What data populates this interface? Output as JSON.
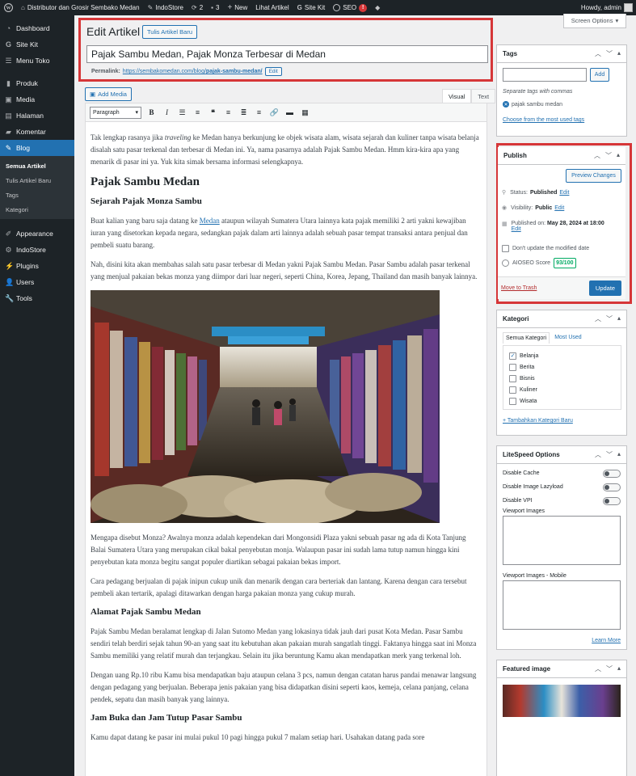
{
  "admin_bar": {
    "site_name": "Distributor dan Grosir Sembako Medan",
    "indostore": "IndoStore",
    "updates_count": "2",
    "comments_count": "3",
    "new_label": "New",
    "view_post": "Lihat Artikel",
    "sitekit": "Site Kit",
    "seo": "SEO",
    "seo_alert": "!",
    "howdy": "Howdy, admin"
  },
  "sidebar": {
    "items": [
      {
        "label": "Dashboard",
        "icon": "dashboard-icon"
      },
      {
        "label": "Site Kit",
        "icon": "sitekit-icon"
      },
      {
        "label": "Menu Toko",
        "icon": "menu-icon"
      },
      {
        "label": "Produk",
        "icon": "product-icon"
      },
      {
        "label": "Media",
        "icon": "media-icon"
      },
      {
        "label": "Halaman",
        "icon": "page-icon"
      },
      {
        "label": "Komentar",
        "icon": "comment-icon"
      },
      {
        "label": "Blog",
        "icon": "pin-icon"
      },
      {
        "label": "Appearance",
        "icon": "appearance-icon"
      },
      {
        "label": "IndoStore",
        "icon": "indostore-icon"
      },
      {
        "label": "Plugins",
        "icon": "plugin-icon"
      },
      {
        "label": "Users",
        "icon": "users-icon"
      },
      {
        "label": "Tools",
        "icon": "tools-icon"
      }
    ],
    "submenu": [
      "Semua Artikel",
      "Tulis Artikel Baru",
      "Tags",
      "Kategori"
    ]
  },
  "screen_options": "Screen Options",
  "editor": {
    "page_title": "Edit Artikel",
    "add_new": "Tulis Artikel Baru",
    "post_title": "Pajak Sambu Medan, Pajak Monza Terbesar di Medan",
    "permalink_label": "Permalink:",
    "permalink_base": "https://sembakomedan.com/blog/",
    "permalink_slug": "pajak-sambu-medan/",
    "permalink_edit": "Edit",
    "add_media": "Add Media",
    "tab_visual": "Visual",
    "tab_text": "Text",
    "format": "Paragraph"
  },
  "content": {
    "intro_1": "Tak lengkap rasanya jika ",
    "intro_em": "traveling",
    "intro_2": " ke Medan hanya berkunjung ke objek wisata alam, wisata sejarah dan kuliner tanpa wisata belanja disalah satu pasar terkenal dan terbesar di Medan ini. Ya, nama pasarnya adalah Pajak Sambu Medan. Hmm kira-kira apa yang menarik di pasar ini ya. Yuk kita simak bersama informasi selengkapnya.",
    "h2": "Pajak Sambu Medan",
    "h3_1": "Sejarah Pajak Monza Sambu",
    "p1_a": "Buat kalian yang baru saja datang ke ",
    "p1_link": "Medan",
    "p1_b": " ataupun wilayah Sumatera Utara lainnya kata pajak memiliki 2 arti yakni kewajiban iuran yang disetorkan kepada negara, sedangkan pajak dalam arti lainnya adalah sebuah pasar tempat transaksi antara penjual dan pembeli suatu barang.",
    "p2": "Nah, disini kita akan membahas salah satu pasar terbesar di Medan yakni Pajak Sambu Medan. Pasar Sambu adalah pasar terkenal yang menjual pakaian bekas  monza yang diimpor dari luar negeri, seperti China, Korea, Jepang, Thailand dan masih banyak lainnya.",
    "p3": "Mengapa disebut Monza? Awalnya monza adalah kependekan dari Mongonsidi Plaza yakni sebuah pasar ng ada di Kota Tanjung Balai Sumatera Utara yang merupakan cikal bakal penyebutan monja. Walaupun pasar ini sudah lama tutup namun hingga kini penyebutan kata monza begitu sangat populer diartikan sebagai pakaian bekas import.",
    "p4": "Cara pedagang berjualan di pajak inipun cukup unik dan menarik dengan cara berteriak dan lantang. Karena dengan cara tersebut pembeli akan tertarik, apalagi ditawarkan dengan harga pakaian monza yang cukup murah.",
    "h3_2": "Alamat Pajak Sambu Medan",
    "p5": "Pajak Sambu Medan beralamat lengkap di Jalan Sutomo Medan yang lokasinya tidak jauh dari pusat Kota Medan. Pasar Sambu sendiri telah berdiri sejak tahun 90-an yang saat itu kebutuhan akan pakaian murah sangatlah tinggi. Faktanya hingga saat ini Monza Sambu memiliki yang relatif murah dan terjangkau. Selain itu jika beruntung Kamu akan mendapatkan merk yang terkenal loh.",
    "p6": "Dengan uang Rp.10 ribu Kamu bisa mendapatkan baju ataupun celana 3 pcs, namun dengan catatan harus pandai menawar langsung dengan pedagang yang berjualan. Beberapa jenis pakaian yang bisa didapatkan disini seperti kaos, kemeja, celana panjang, celana pendek, sepatu dan masih banyak yang lainnya.",
    "h3_3": "Jam Buka dan Jam Tutup Pasar Sambu",
    "p7": "Kamu dapat datang ke pasar ini mulai pukul 10 pagi hingga pukul 7 malam setiap hari. Usahakan datang pada sore"
  },
  "tags_box": {
    "title": "Tags",
    "add": "Add",
    "hint": "Separate tags with commas",
    "tag": "pajak sambu medan",
    "choose": "Choose from the most used tags"
  },
  "publish_box": {
    "title": "Publish",
    "preview": "Preview Changes",
    "status_label": "Status:",
    "status_value": "Published",
    "visibility_label": "Visibility:",
    "visibility_value": "Public",
    "published_label": "Published on:",
    "published_value": "May 28, 2024 at 18:00",
    "edit": "Edit",
    "dont_update": "Don't update the modified date",
    "aioseo_label": "AIOSEO Score",
    "aioseo_score": "93/100",
    "trash": "Move to Trash",
    "update": "Update"
  },
  "kategori_box": {
    "title": "Kategori",
    "tab_all": "Semua Kategori",
    "tab_used": "Most Used",
    "items": [
      {
        "label": "Belanja",
        "checked": "✓"
      },
      {
        "label": "Berita",
        "checked": ""
      },
      {
        "label": "Bisnis",
        "checked": ""
      },
      {
        "label": "Kuliner",
        "checked": ""
      },
      {
        "label": "Wisata",
        "checked": ""
      }
    ],
    "add_new": "+ Tambahkan Kategori Baru"
  },
  "litespeed_box": {
    "title": "LiteSpeed Options",
    "toggles": [
      "Disable Cache",
      "Disable Image Lazyload",
      "Disable VPI"
    ],
    "viewport_label": "Viewport Images",
    "viewport_mobile_label": "Viewport Images - Mobile",
    "learn_more": "Learn More"
  },
  "featured_box": {
    "title": "Featured image"
  },
  "colors": {
    "accent": "#2271b1",
    "highlight": "#d63638",
    "admin_dark": "#1d2327"
  }
}
